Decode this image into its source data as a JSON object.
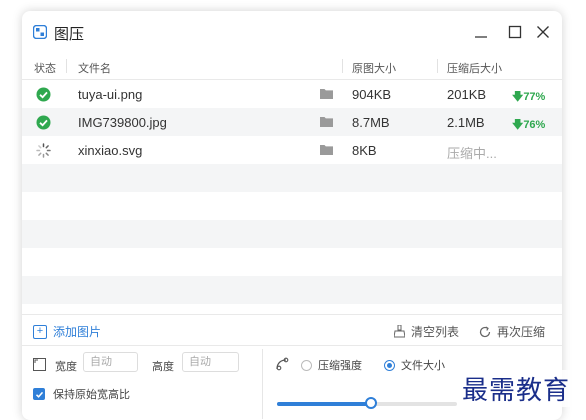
{
  "app": {
    "title": "图压"
  },
  "table": {
    "headers": {
      "status": "状态",
      "filename": "文件名",
      "original": "原图大小",
      "compressed": "压缩后大小"
    },
    "rows": [
      {
        "status": "done",
        "filename": "tuya-ui.png",
        "original": "904KB",
        "compressed": "201KB",
        "ratio": "77%"
      },
      {
        "status": "done",
        "filename": "IMG739800.jpg",
        "original": "8.7MB",
        "compressed": "2.1MB",
        "ratio": "76%"
      },
      {
        "status": "loading",
        "filename": "xinxiao.svg",
        "original": "8KB",
        "compressed": "压缩中...",
        "ratio": ""
      }
    ]
  },
  "toolbar": {
    "add": "添加图片",
    "clear": "清空列表",
    "recompress": "再次压缩"
  },
  "settings": {
    "width_label": "宽度",
    "width_placeholder": "自动",
    "height_label": "高度",
    "height_placeholder": "自动",
    "keep_ratio_label": "保持原始宽高比",
    "keep_ratio_checked": true,
    "mode_strength_label": "压缩强度",
    "mode_size_label": "文件大小",
    "selected_mode": "文件大小",
    "slider_fraction": 0.52
  },
  "watermark": "最需教育",
  "colors": {
    "accent": "#2f7fd8",
    "success": "#2fa84f"
  }
}
